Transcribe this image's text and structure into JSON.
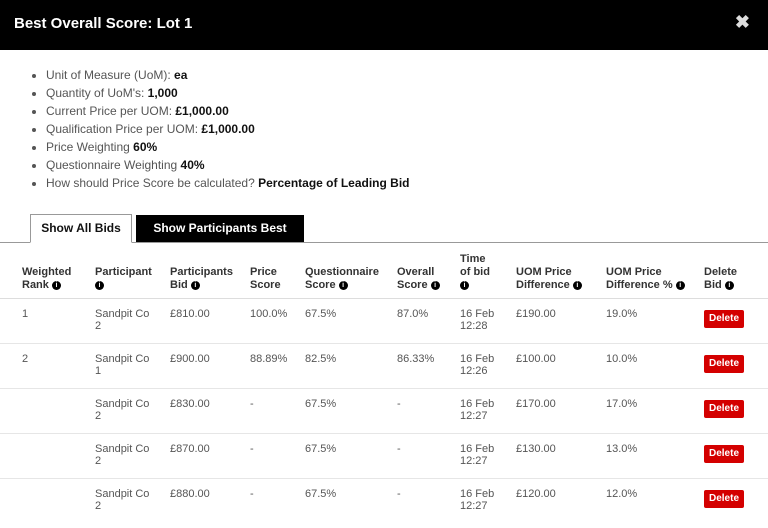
{
  "modal": {
    "title": "Best Overall Score: Lot 1",
    "close_glyph": "✖"
  },
  "info": [
    {
      "label": "Unit of Measure (UoM): ",
      "value": "ea"
    },
    {
      "label": "Quantity of UoM's: ",
      "value": "1,000"
    },
    {
      "label": "Current Price per UOM: ",
      "value": "£1,000.00"
    },
    {
      "label": "Qualification Price per UOM: ",
      "value": "£1,000.00"
    },
    {
      "label": "Price Weighting ",
      "value": "60%"
    },
    {
      "label": "Questionnaire Weighting ",
      "value": "40%"
    },
    {
      "label": "How should Price Score be calculated? ",
      "value": "Percentage of Leading Bid"
    }
  ],
  "tabs": {
    "all": "Show All Bids",
    "best": "Show Participants Best Bids"
  },
  "table": {
    "headers": [
      {
        "l1": "Weighted",
        "l2": "Rank",
        "icon": true
      },
      {
        "l1": "Participant",
        "l2": "",
        "icon": true
      },
      {
        "l1": "Participants",
        "l2": "Bid",
        "icon": true
      },
      {
        "l1": "Price",
        "l2": "Score",
        "icon": false
      },
      {
        "l1": "Questionnaire",
        "l2": "Score",
        "icon": true
      },
      {
        "l1": "Overall",
        "l2": "Score",
        "icon": true
      },
      {
        "l0": "Time",
        "l1": "of bid",
        "l2": "",
        "icon": true
      },
      {
        "l1": "UOM Price",
        "l2": "Difference",
        "icon": true
      },
      {
        "l1": "UOM Price",
        "l2": "Difference %",
        "icon": true
      },
      {
        "l1": "Delete",
        "l2": "Bid",
        "icon": true
      }
    ],
    "info_glyph": "i",
    "delete_label": "Delete",
    "rows": [
      {
        "rank": "1",
        "p1": "Sandpit Co",
        "p2": "2",
        "bid": "£810.00",
        "price": "100.0%",
        "q": "67.5%",
        "overall": "87.0%",
        "t1": "16 Feb",
        "t2": "12:28",
        "diff": "£190.00",
        "diffp": "19.0%"
      },
      {
        "rank": "2",
        "p1": "Sandpit Co",
        "p2": "1",
        "bid": "£900.00",
        "price": "88.89%",
        "q": "82.5%",
        "overall": "86.33%",
        "t1": "16 Feb",
        "t2": "12:26",
        "diff": "£100.00",
        "diffp": "10.0%"
      },
      {
        "rank": "",
        "p1": "Sandpit Co",
        "p2": "2",
        "bid": "£830.00",
        "price": "-",
        "q": "67.5%",
        "overall": "-",
        "t1": "16 Feb",
        "t2": "12:27",
        "diff": "£170.00",
        "diffp": "17.0%"
      },
      {
        "rank": "",
        "p1": "Sandpit Co",
        "p2": "2",
        "bid": "£870.00",
        "price": "-",
        "q": "67.5%",
        "overall": "-",
        "t1": "16 Feb",
        "t2": "12:27",
        "diff": "£130.00",
        "diffp": "13.0%"
      },
      {
        "rank": "",
        "p1": "Sandpit Co",
        "p2": "2",
        "bid": "£880.00",
        "price": "-",
        "q": "67.5%",
        "overall": "-",
        "t1": "16 Feb",
        "t2": "12:27",
        "diff": "£120.00",
        "diffp": "12.0%"
      }
    ]
  }
}
